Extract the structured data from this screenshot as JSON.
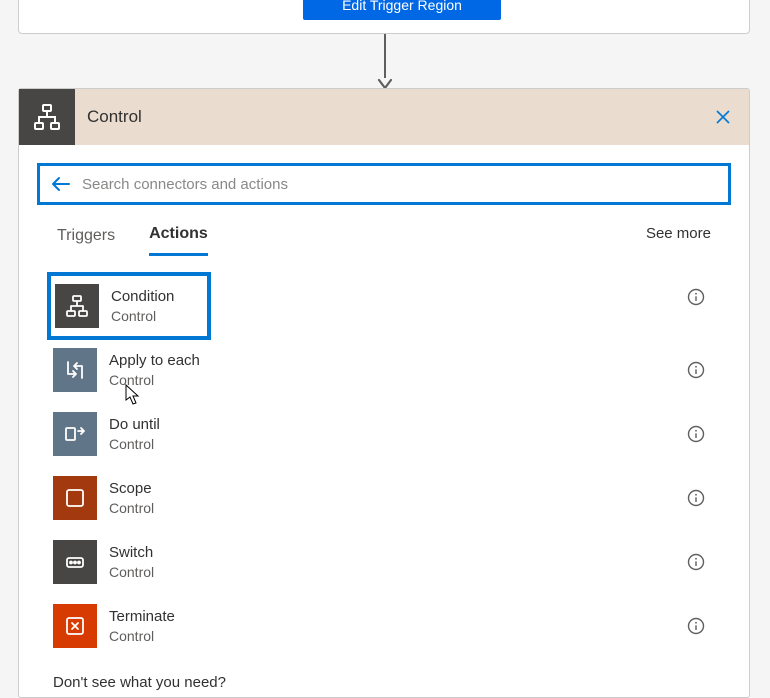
{
  "topButton": {
    "label": "Edit Trigger Region"
  },
  "panel": {
    "title": "Control",
    "search": {
      "placeholder": "Search connectors and actions"
    },
    "tabs": {
      "triggers": "Triggers",
      "actions": "Actions",
      "seeMore": "See more"
    },
    "actions": [
      {
        "name": "Condition",
        "connector": "Control",
        "iconBg": "#484644",
        "iconType": "condition"
      },
      {
        "name": "Apply to each",
        "connector": "Control",
        "iconBg": "#617589",
        "iconType": "apply"
      },
      {
        "name": "Do until",
        "connector": "Control",
        "iconBg": "#617589",
        "iconType": "dountil"
      },
      {
        "name": "Scope",
        "connector": "Control",
        "iconBg": "#a33a0f",
        "iconType": "scope"
      },
      {
        "name": "Switch",
        "connector": "Control",
        "iconBg": "#484644",
        "iconType": "switch"
      },
      {
        "name": "Terminate",
        "connector": "Control",
        "iconBg": "#d83b01",
        "iconType": "terminate"
      }
    ],
    "footer": "Don't see what you need?"
  }
}
